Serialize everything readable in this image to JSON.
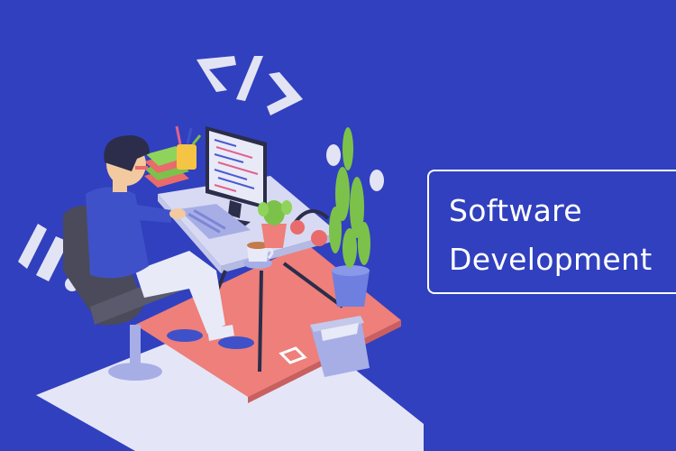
{
  "colors": {
    "background": "#3140BE",
    "text": "#FFFFFF",
    "floor": "#E4E6F8",
    "rug": "#EE7F7A",
    "shirt": "#3F51C8",
    "chair": "#4A4A5A",
    "plant": "#7CC24A"
  },
  "banner": {
    "line1": "Software",
    "line2": "Development"
  },
  "illustration": {
    "code_symbol": "</>",
    "icons": [
      "code-brackets-icon",
      "monitor-icon",
      "keyboard-icon",
      "coffee-cup-icon",
      "headphones-icon",
      "cactus-icon",
      "plant-icon",
      "trash-bin-icon",
      "books-icon",
      "pencil-cup-icon"
    ]
  }
}
